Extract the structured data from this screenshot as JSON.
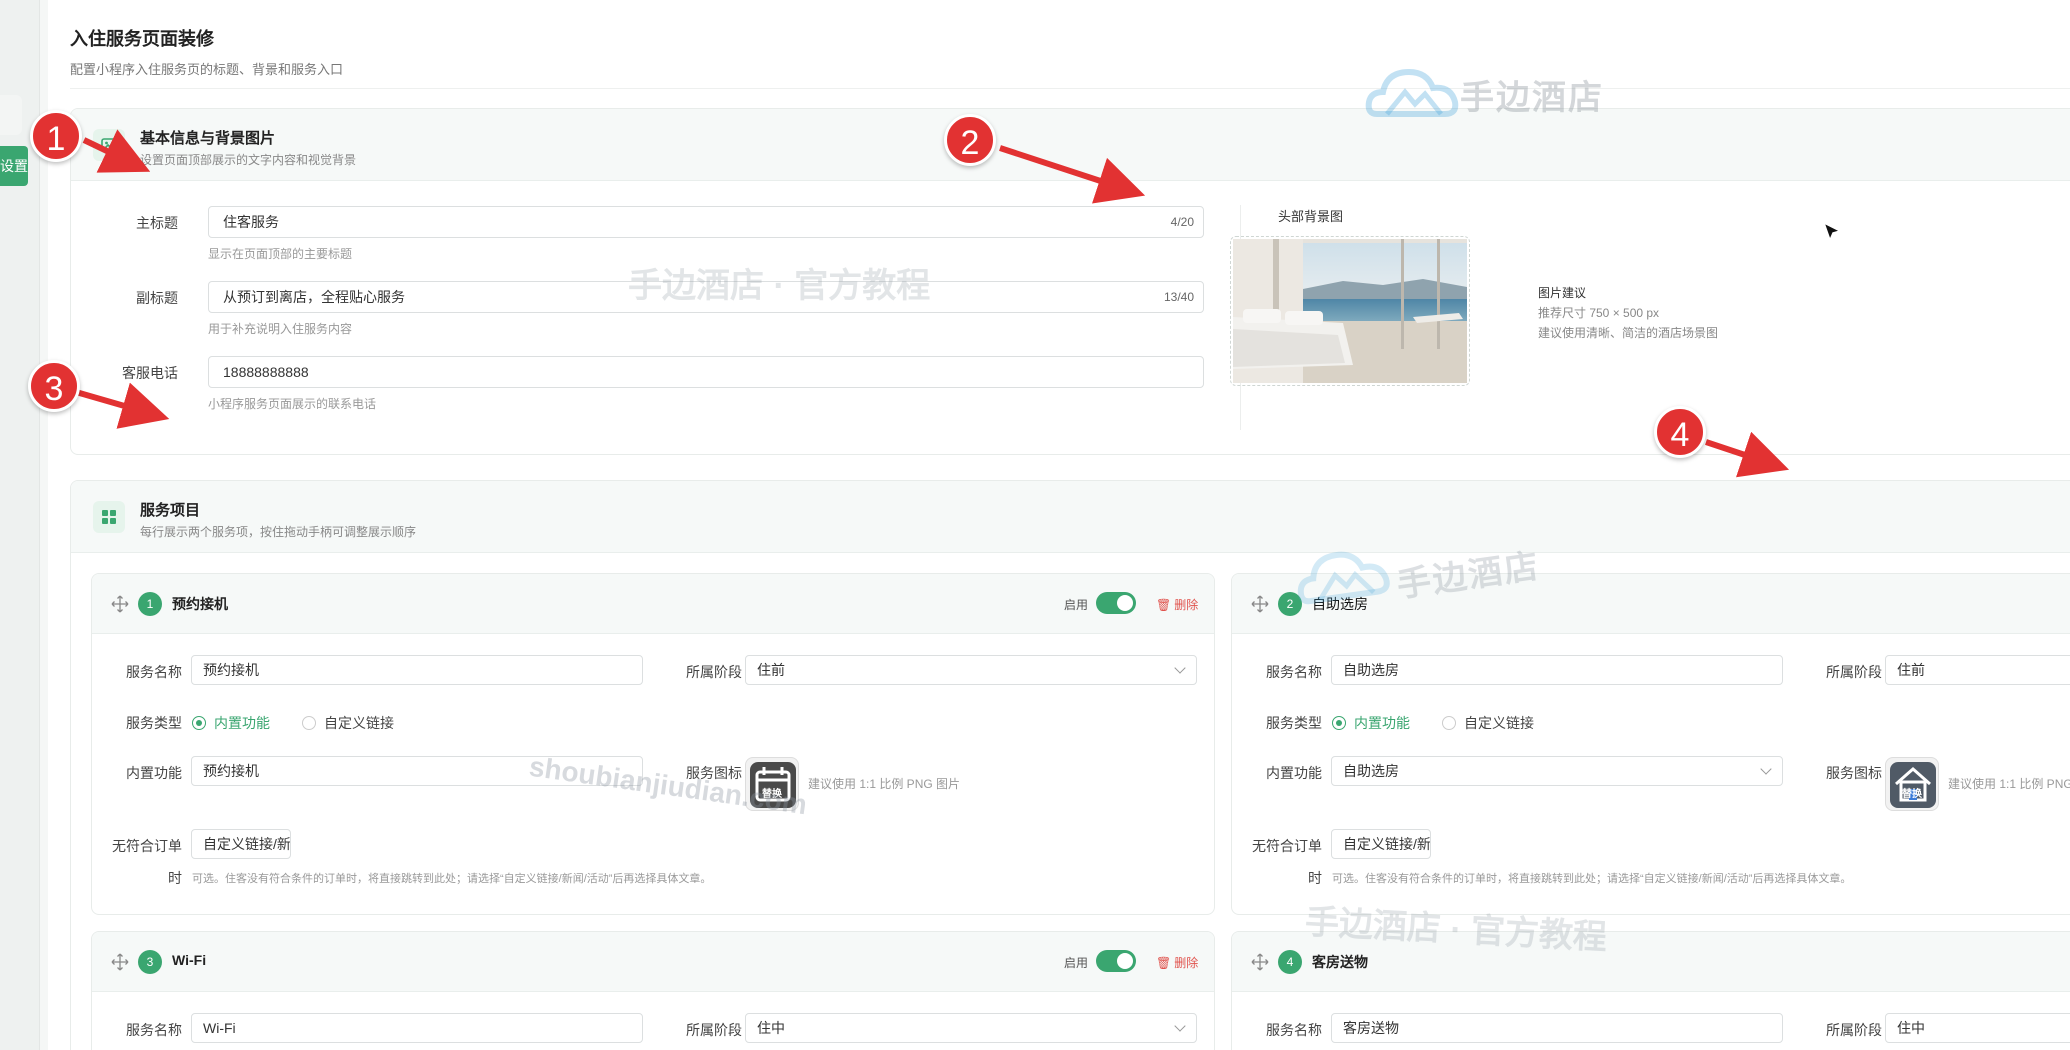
{
  "sidebar": {
    "tab_label": "设置"
  },
  "page": {
    "title": "入住服务页面装修",
    "subtitle": "配置小程序入住服务页的标题、背景和服务入口"
  },
  "basic": {
    "title": "基本信息与背景图片",
    "desc": "设置页面顶部展示的文字内容和视觉背景",
    "fields": {
      "main_title": {
        "label": "主标题",
        "value": "住客服务",
        "count": "4/20",
        "hint": "显示在页面顶部的主要标题"
      },
      "sub_title": {
        "label": "副标题",
        "value": "从预订到离店，全程贴心服务",
        "count": "13/40",
        "hint": "用于补充说明入住服务内容"
      },
      "phone": {
        "label": "客服电话",
        "value": "18888888888",
        "hint": "小程序服务页面展示的联系电话"
      }
    },
    "bg": {
      "label": "头部背景图",
      "tip_title": "图片建议",
      "tip_size": "推荐尺寸 750 × 500 px",
      "tip_desc": "建议使用清晰、简洁的酒店场景图"
    }
  },
  "services": {
    "title": "服务项目",
    "desc": "每行展示两个服务项，按住拖动手柄可调整展示顺序",
    "labels": {
      "enable": "启用",
      "delete": "删除",
      "name": "服务名称",
      "stage": "所属阶段",
      "type": "服务类型",
      "builtin_opt": "内置功能",
      "custom_opt": "自定义链接",
      "builtin": "内置功能",
      "icon": "服务图标",
      "icon_hint": "建议使用 1:1 比例 PNG 图片",
      "icon_hint_short": "建议使用 1:1 比例 PNG",
      "replace": "替换",
      "no_order_1": "无符合订单",
      "no_order_2": "时",
      "no_order_value": "自定义链接/新闻/活动",
      "no_order_hint": "可选。住客没有符合条件的订单时，将直接跳转到此处；请选择“自定义链接/新闻/活动”后再选择具体文章。"
    },
    "items": [
      {
        "index": "1",
        "name": "预约接机",
        "stage": "住前",
        "builtin": "预约接机"
      },
      {
        "index": "2",
        "name": "自助选房",
        "stage": "住前",
        "builtin": "自助选房"
      },
      {
        "index": "3",
        "name": "Wi-Fi",
        "stage": "住中"
      },
      {
        "index": "4",
        "name": "客房送物",
        "stage": "住中"
      }
    ]
  },
  "watermarks": {
    "brand": "手边酒店",
    "tutorial": "手边酒店 · 官方教程",
    "url": "shoubianjiudian.com"
  },
  "annotations": [
    "1",
    "2",
    "3",
    "4"
  ],
  "colors": {
    "accent": "#3aa670",
    "danger": "#e0524c",
    "annotation": "#e23232"
  }
}
